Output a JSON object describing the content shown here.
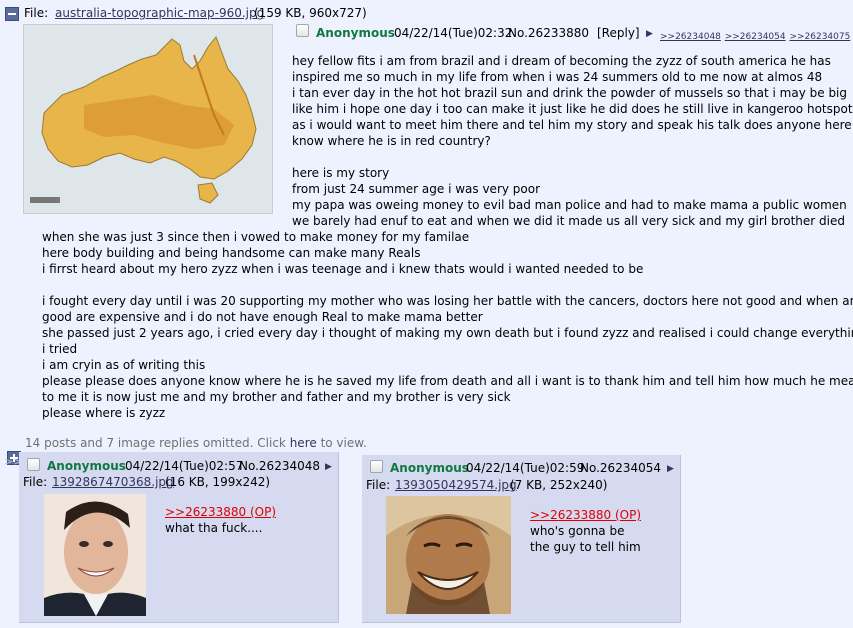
{
  "op": {
    "file_label": "File:",
    "file_name": "australia-topographic-map-960.jpg",
    "file_info": "(159 KB, 960x727)",
    "name": "Anonymous",
    "datetime": "04/22/14(Tue)02:32",
    "post_no": "No.26233880",
    "reply_link": "[Reply]",
    "backlinks": [
      ">>26234048",
      ">>26234054",
      ">>26234075"
    ],
    "lines": [
      "hey fellow fits i am from brazil and i dream of becoming the zyzz of south america he has",
      "inspired me so much in my life from when i was 24 summers old to me now at almos 48",
      "i tan ever day in the hot hot brazil sun and drink the powder of mussels so that i may be big",
      "like him i hope one day i too can make it just like he did does he still live in kangeroo hotspot",
      "as i would want to meet him there and tel him my story and speak his talk does anyone here",
      "know where he is in red country?",
      "",
      "here is my story",
      "from just 24 summer age i was very poor",
      "my papa was oweing money to evil bad man police and had to make mama a public women",
      "we barely had enuf to eat and when we did it made us all very sick and my girl brother died",
      "when she was just 3 since then i vowed to make money for my familae",
      "here body building and being handsome can make many Reals",
      "i firrst heard about my hero zyzz when i was teenage and i knew thats would i wanted needed to be",
      "",
      "i fought every day until i was 20 supporting my mother who was losing her battle with the cancers, doctors here not good and when are",
      "good are expensive and i do not have enough Real to make mama better",
      "she passed just 2 years ago, i cried every day i thought of making my own death but i found zyzz and realised i could change everything if",
      "i tried",
      "i am cryin as of writing this",
      "please please does anyone know where he is he saved my life from death and all i want is to thank him and tell him how much he means",
      "to me it is now just me and my brother and father and my brother is very sick",
      "please where is zyzz"
    ]
  },
  "omitted": {
    "text_before": "14 posts and 7 image replies omitted. Click ",
    "link": "here",
    "text_after": " to view."
  },
  "replies": [
    {
      "arrow": ">>",
      "name": "Anonymous",
      "datetime": "04/22/14(Tue)02:57",
      "post_no": "No.26234048",
      "file_label": "File:",
      "file_name": "1392867470368.jpg",
      "file_info": "(16 KB, 199x242)",
      "quote": ">>26233880 (OP)",
      "text": [
        "what tha fuck...."
      ]
    },
    {
      "name": "Anonymous",
      "datetime": "04/22/14(Tue)02:59",
      "post_no": "No.26234054",
      "file_label": "File:",
      "file_name": "1393050429574.jpg",
      "file_info": "(7 KB, 252x240)",
      "quote": ">>26233880 (OP)",
      "text": [
        "who's gonna be",
        "the guy to tell him"
      ]
    }
  ],
  "colors": {
    "background": "#eef2ff",
    "reply_bg": "#d6daf0",
    "name": "#117743",
    "quote": "#dd0000",
    "link": "#34345c"
  },
  "icons": [
    "collapse-icon",
    "expand-icon",
    "checkbox",
    "menu-arrow-icon"
  ]
}
